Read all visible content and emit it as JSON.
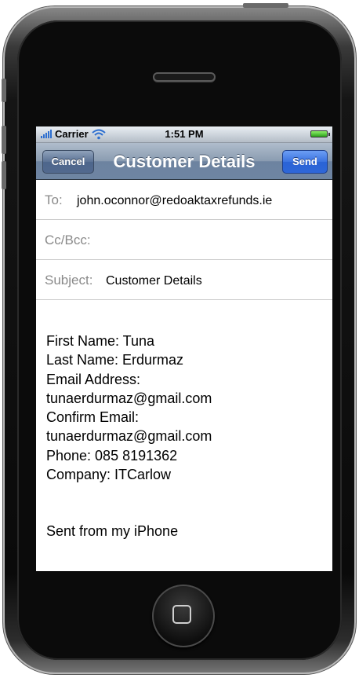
{
  "status_bar": {
    "carrier": "Carrier",
    "time": "1:51 PM",
    "signal_icon": "signal-bars-icon",
    "wifi_icon": "wifi-icon",
    "battery_icon": "battery-icon"
  },
  "nav": {
    "title": "Customer Details",
    "cancel_label": "Cancel",
    "send_label": "Send"
  },
  "fields": {
    "to_label": "To:",
    "to_value": "john.oconnor@redoaktaxrefunds.ie",
    "ccbcc_label": "Cc/Bcc:",
    "subject_label": "Subject:",
    "subject_value": "Customer Details"
  },
  "body": {
    "lines": [
      "First Name: Tuna",
      "Last Name: Erdurmaz",
      "Email Address:",
      "tunaerdurmaz@gmail.com",
      "Confirm Email:",
      "tunaerdurmaz@gmail.com",
      "Phone: 085 8191362",
      "Company: ITCarlow"
    ],
    "signature": "Sent from my iPhone"
  },
  "colors": {
    "navbar": "#7a8fab",
    "send_button": "#3a72e0",
    "label_gray": "#8a8a8a"
  }
}
